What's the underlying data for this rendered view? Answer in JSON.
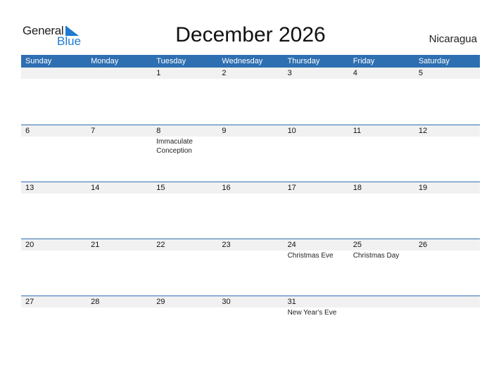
{
  "logo": {
    "general": "General",
    "blue": "Blue"
  },
  "title": "December 2026",
  "country": "Nicaragua",
  "colors": {
    "header": "#2e6fb1",
    "band": "#f1f1f1",
    "brand": "#1f7bd0"
  },
  "weekdays": [
    "Sunday",
    "Monday",
    "Tuesday",
    "Wednesday",
    "Thursday",
    "Friday",
    "Saturday"
  ],
  "weeks": [
    {
      "days": [
        {
          "n": "",
          "e": ""
        },
        {
          "n": "",
          "e": ""
        },
        {
          "n": "1",
          "e": ""
        },
        {
          "n": "2",
          "e": ""
        },
        {
          "n": "3",
          "e": ""
        },
        {
          "n": "4",
          "e": ""
        },
        {
          "n": "5",
          "e": ""
        }
      ]
    },
    {
      "days": [
        {
          "n": "6",
          "e": ""
        },
        {
          "n": "7",
          "e": ""
        },
        {
          "n": "8",
          "e": "Immaculate Conception"
        },
        {
          "n": "9",
          "e": ""
        },
        {
          "n": "10",
          "e": ""
        },
        {
          "n": "11",
          "e": ""
        },
        {
          "n": "12",
          "e": ""
        }
      ]
    },
    {
      "days": [
        {
          "n": "13",
          "e": ""
        },
        {
          "n": "14",
          "e": ""
        },
        {
          "n": "15",
          "e": ""
        },
        {
          "n": "16",
          "e": ""
        },
        {
          "n": "17",
          "e": ""
        },
        {
          "n": "18",
          "e": ""
        },
        {
          "n": "19",
          "e": ""
        }
      ]
    },
    {
      "days": [
        {
          "n": "20",
          "e": ""
        },
        {
          "n": "21",
          "e": ""
        },
        {
          "n": "22",
          "e": ""
        },
        {
          "n": "23",
          "e": ""
        },
        {
          "n": "24",
          "e": "Christmas Eve"
        },
        {
          "n": "25",
          "e": "Christmas Day"
        },
        {
          "n": "26",
          "e": ""
        }
      ]
    },
    {
      "days": [
        {
          "n": "27",
          "e": ""
        },
        {
          "n": "28",
          "e": ""
        },
        {
          "n": "29",
          "e": ""
        },
        {
          "n": "30",
          "e": ""
        },
        {
          "n": "31",
          "e": "New Year's Eve"
        },
        {
          "n": "",
          "e": ""
        },
        {
          "n": "",
          "e": ""
        }
      ]
    }
  ]
}
